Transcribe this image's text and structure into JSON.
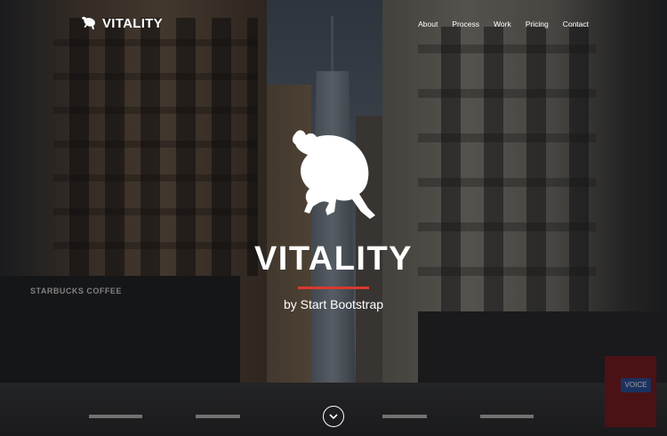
{
  "brand": {
    "name": "VITALITY"
  },
  "nav": {
    "items": [
      {
        "label": "About"
      },
      {
        "label": "Process"
      },
      {
        "label": "Work"
      },
      {
        "label": "Pricing"
      },
      {
        "label": "Contact"
      }
    ]
  },
  "hero": {
    "title": "VITALITY",
    "subtitle": "by Start Bootstrap",
    "scroll_icon": "chevron-down-icon",
    "divider_color": "#d9392f"
  },
  "background": {
    "storefront_sign": "STARBUCKS COFFEE",
    "street_sign": "VOICE"
  }
}
